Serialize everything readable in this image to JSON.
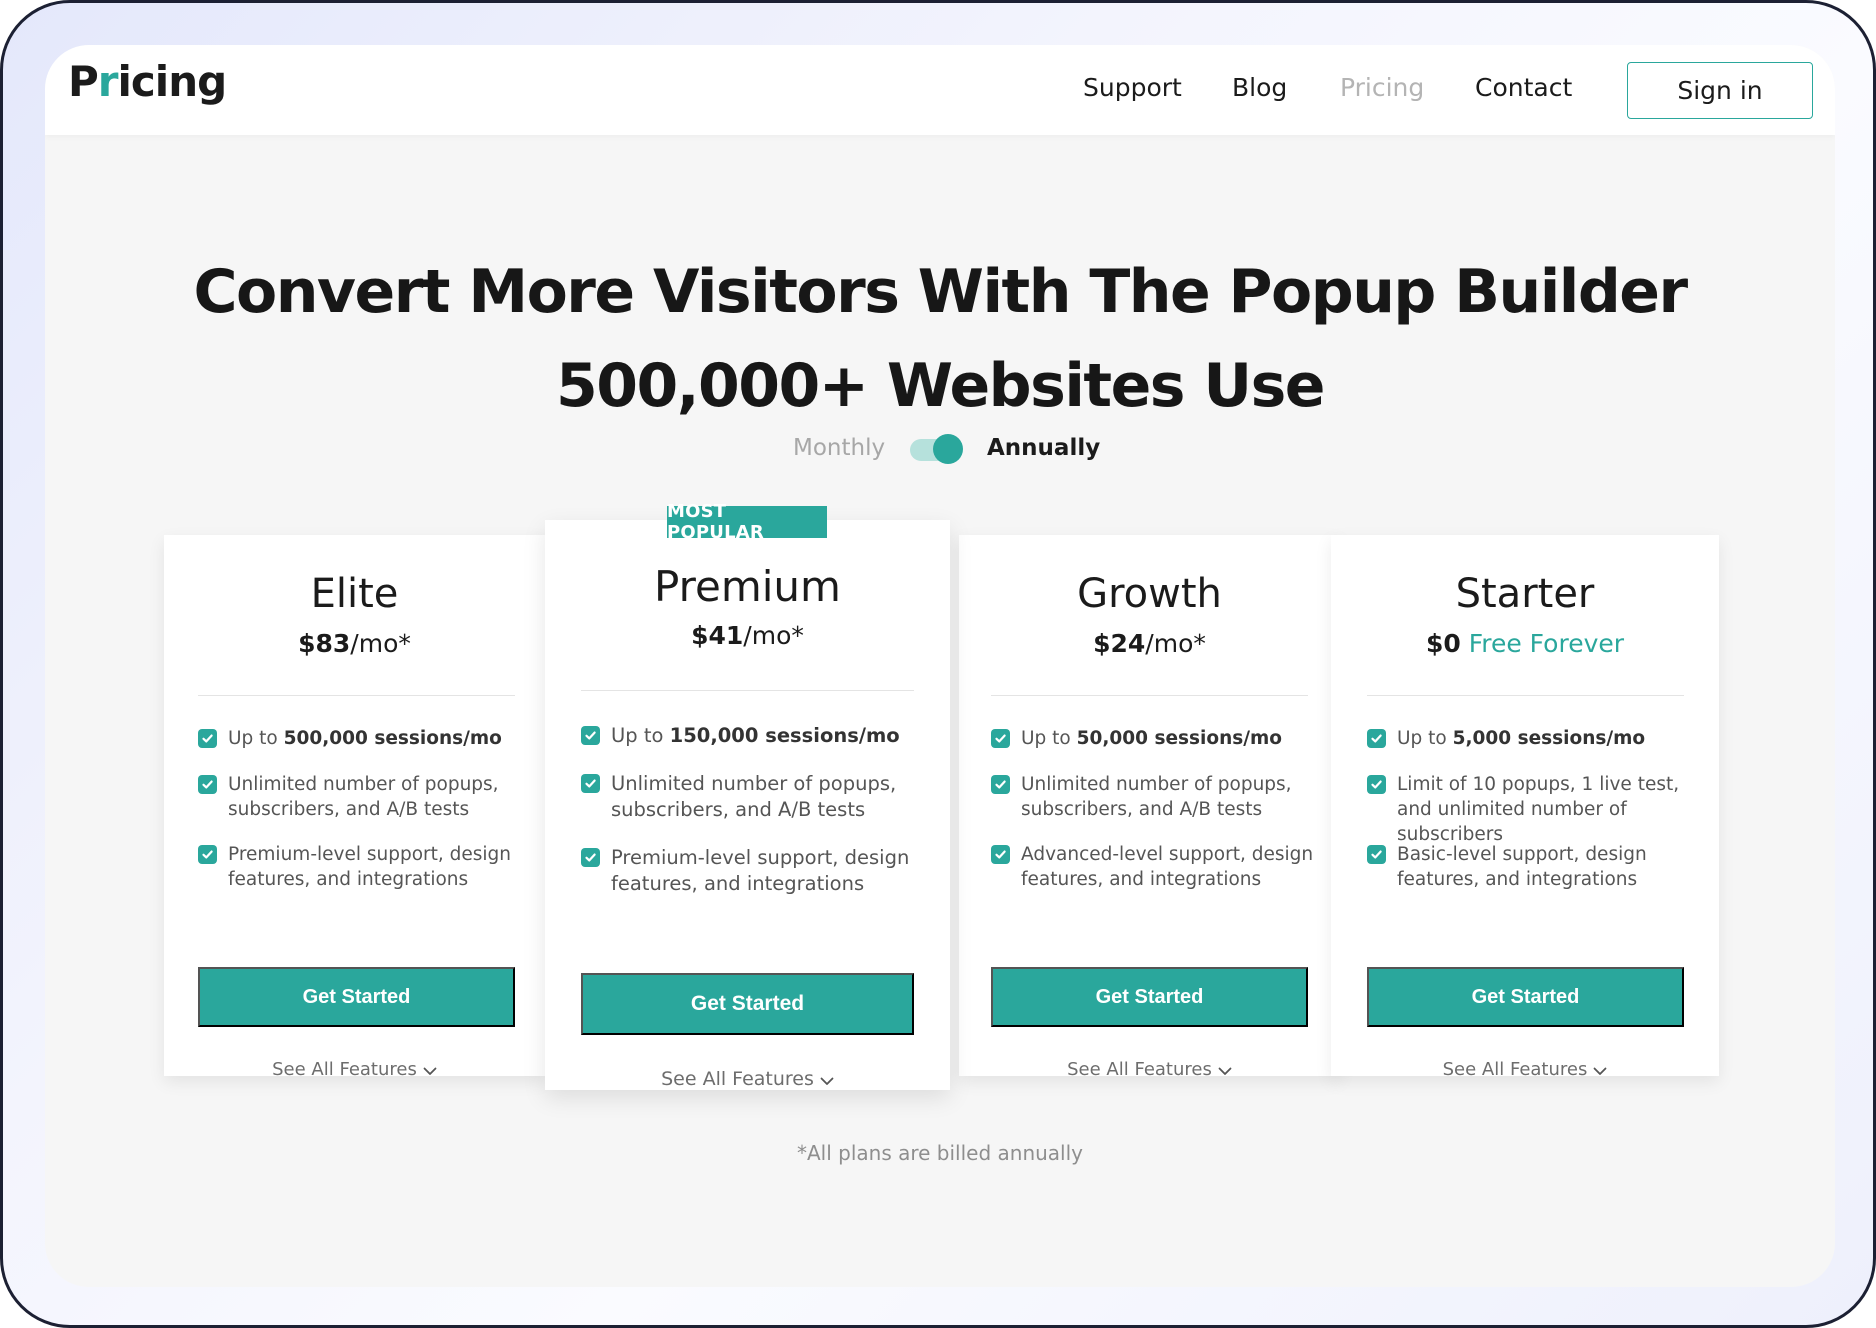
{
  "header": {
    "logo_prefix": "P",
    "logo_accent": "r",
    "logo_suffix": "icing",
    "nav": [
      "Support",
      "Blog",
      "Pricing",
      "Contact"
    ],
    "active_nav": "Pricing",
    "sign_in": "Sign in"
  },
  "hero": {
    "title_line1": "Convert More Visitors With The Popup Builder",
    "title_line2": "500,000+ Websites Use"
  },
  "billing_toggle": {
    "monthly": "Monthly",
    "annually": "Annually",
    "selected": "Annually"
  },
  "plans": [
    {
      "name": "Elite",
      "price_amount": "$83",
      "price_unit": "/mo*",
      "features": [
        {
          "pre": "Up to ",
          "bold": "500,000 sessions/mo",
          "post": ""
        },
        {
          "pre": "Unlimited number of popups, subscribers, and A/B tests",
          "bold": "",
          "post": ""
        },
        {
          "pre": "Premium-level support, design features, and integrations",
          "bold": "",
          "post": ""
        }
      ],
      "cta": "Get Started",
      "see_all": "See All Features"
    },
    {
      "name": "Premium",
      "badge": "MOST POPULAR",
      "price_amount": "$41",
      "price_unit": "/mo*",
      "features": [
        {
          "pre": "Up to ",
          "bold": "150,000 sessions/mo",
          "post": ""
        },
        {
          "pre": "Unlimited number of popups, subscribers, and A/B tests",
          "bold": "",
          "post": ""
        },
        {
          "pre": "Premium-level support, design features, and integrations",
          "bold": "",
          "post": ""
        }
      ],
      "cta": "Get Started",
      "see_all": "See All Features"
    },
    {
      "name": "Growth",
      "price_amount": "$24",
      "price_unit": "/mo*",
      "features": [
        {
          "pre": "Up to ",
          "bold": "50,000 sessions/mo",
          "post": ""
        },
        {
          "pre": "Unlimited number of popups, subscribers, and A/B tests",
          "bold": "",
          "post": ""
        },
        {
          "pre": "Advanced-level support, design features, and integrations",
          "bold": "",
          "post": ""
        }
      ],
      "cta": "Get Started",
      "see_all": "See All Features"
    },
    {
      "name": "Starter",
      "price_amount": "$0",
      "price_unit": "Free Forever",
      "features": [
        {
          "pre": "Up to ",
          "bold": "5,000 sessions/mo",
          "post": ""
        },
        {
          "pre": "Limit of 10 popups, 1 live test, and unlimited number of subscribers",
          "bold": "",
          "post": ""
        },
        {
          "pre": "Basic-level support, design features, and integrations",
          "bold": "",
          "post": ""
        }
      ],
      "cta": "Get Started",
      "see_all": "See All Features"
    }
  ],
  "footnote": "*All plans are billed annually",
  "colors": {
    "accent": "#2aa79c",
    "text": "#1b1b1b",
    "muted": "#a7a7a7",
    "page_bg": "#f6f6f6"
  }
}
